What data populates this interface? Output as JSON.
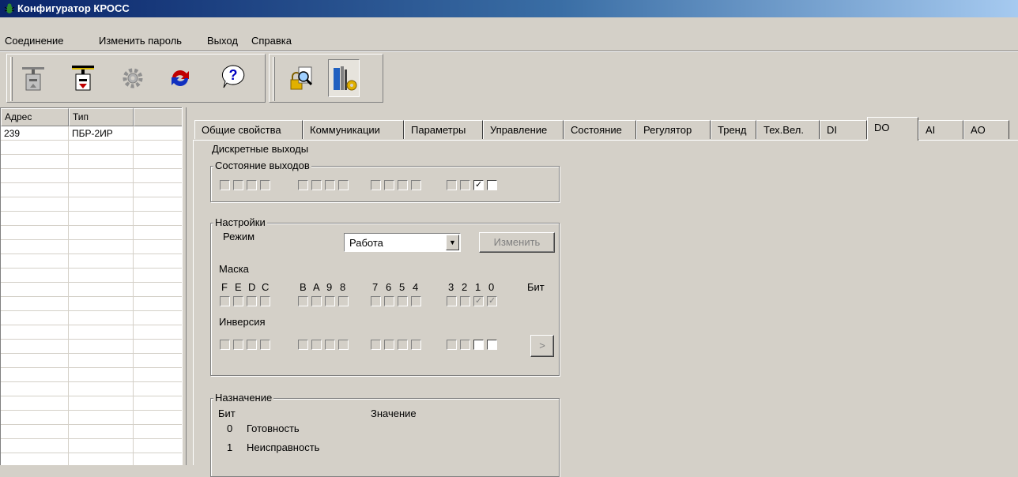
{
  "window": {
    "title": "Конфигуратор КРОСС"
  },
  "menu": [
    "Соединение",
    "Изменить пароль",
    "Выход",
    "Справка"
  ],
  "toolbar": {
    "icons": [
      "connect-device-icon",
      "disconnect-device-icon",
      "settings-gear-icon",
      "refresh-icon",
      "help-icon",
      "search-config-icon",
      "configure-tools-icon"
    ]
  },
  "device_list": {
    "columns": [
      "Адрес",
      "Тип"
    ],
    "rows": [
      {
        "address": "239",
        "type": "ПБР-2ИР"
      }
    ]
  },
  "tabs": [
    "Общие свойства",
    "Коммуникации",
    "Параметры",
    "Управление",
    "Состояние",
    "Регулятор",
    "Тренд",
    "Тех.Вел.",
    "DI",
    "DO",
    "AI",
    "AO"
  ],
  "active_tab": "DO",
  "panel": {
    "title": "Дискретные выходы",
    "outputs_group": {
      "title": "Состояние выходов",
      "checked_bits": [
        1
      ]
    },
    "settings_group": {
      "title": "Настройки",
      "mode_label": "Режим",
      "mode_value": "Работа",
      "change_button": "Изменить",
      "mask_label": "Маска",
      "bit_headers": [
        "F",
        "E",
        "D",
        "C",
        "B",
        "A",
        "9",
        "8",
        "7",
        "6",
        "5",
        "4",
        "3",
        "2",
        "1",
        "0"
      ],
      "bit_label": "Бит",
      "mask_checked_bits": [
        1,
        0
      ],
      "inversion_label": "Инверсия",
      "apply_button": ">"
    },
    "assignment_group": {
      "title": "Назначение",
      "col_bit": "Бит",
      "col_value": "Значение",
      "rows": [
        {
          "bit": "0",
          "value": "Готовность"
        },
        {
          "bit": "1",
          "value": "Неисправность"
        }
      ]
    }
  }
}
